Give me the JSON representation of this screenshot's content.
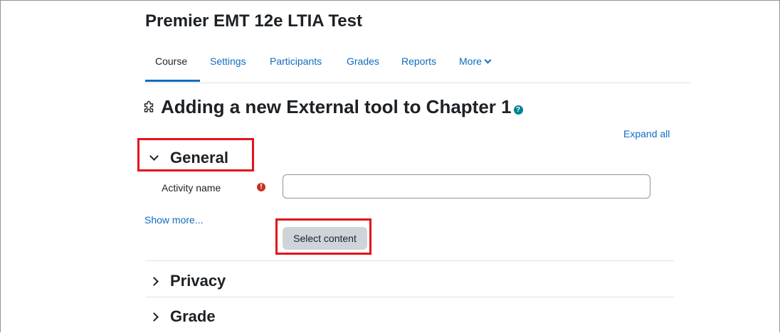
{
  "course": {
    "title": "Premier EMT 12e LTIA Test"
  },
  "nav": {
    "items": [
      {
        "label": "Course",
        "active": true
      },
      {
        "label": "Settings"
      },
      {
        "label": "Participants"
      },
      {
        "label": "Grades"
      },
      {
        "label": "Reports"
      },
      {
        "label": "More"
      }
    ]
  },
  "page": {
    "heading": "Adding a new External tool to Chapter 1",
    "heading_icon": "puzzle-icon",
    "help_icon": "question-icon",
    "expand_all": "Expand all"
  },
  "sections": {
    "general": {
      "label": "General",
      "expanded": true
    },
    "privacy": {
      "label": "Privacy",
      "expanded": false
    },
    "grade": {
      "label": "Grade",
      "expanded": false
    }
  },
  "form": {
    "activity_name_label": "Activity name",
    "activity_name_value": "",
    "required_icon": "!",
    "show_more": "Show more...",
    "select_content": "Select content"
  },
  "colors": {
    "link": "#0f6cbf",
    "highlight": "#e3131b",
    "required": "#ca3120",
    "help": "#008196",
    "button_bg": "#ced4da"
  }
}
